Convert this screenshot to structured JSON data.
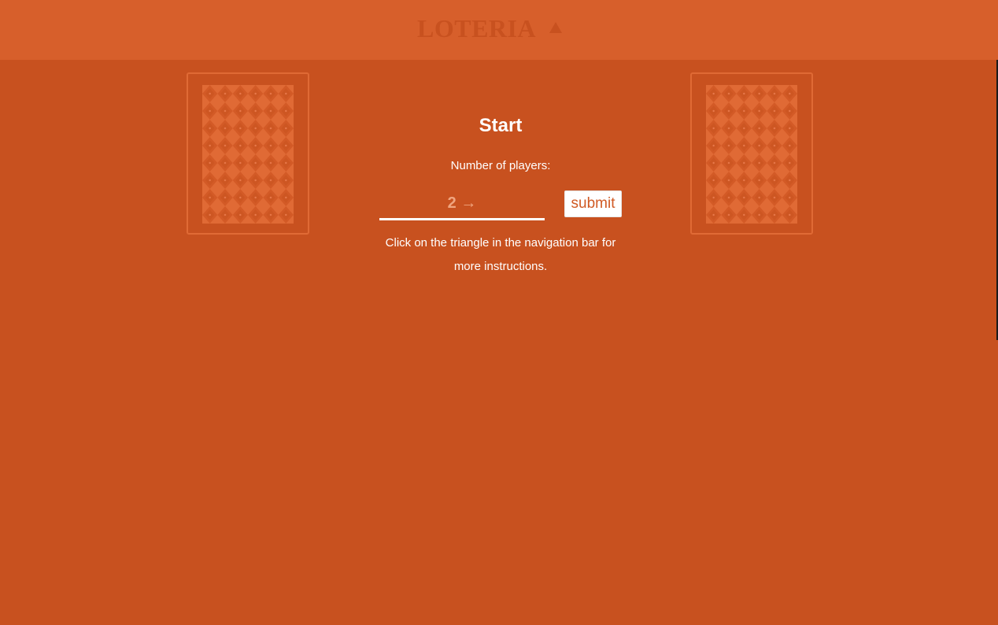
{
  "navbar": {
    "brand": "LOTERIA",
    "menu_icon": "triangle-up-icon"
  },
  "cards": {
    "left": {
      "pattern": "diamond-pattern"
    },
    "right": {
      "pattern": "diamond-pattern"
    }
  },
  "start": {
    "title": "Start",
    "players_label": "Number of players:",
    "players_placeholder": "2 →",
    "submit_label": "submit",
    "instructions_line1": "Click on the triangle in the navigation bar for",
    "instructions_line2": "more instructions."
  },
  "colors": {
    "background": "#c8511f",
    "navbar": "#d75f2b",
    "card_border": "#e06a35",
    "text": "#ffffff",
    "placeholder": "#f0a57f",
    "button_text": "#d05a24"
  }
}
